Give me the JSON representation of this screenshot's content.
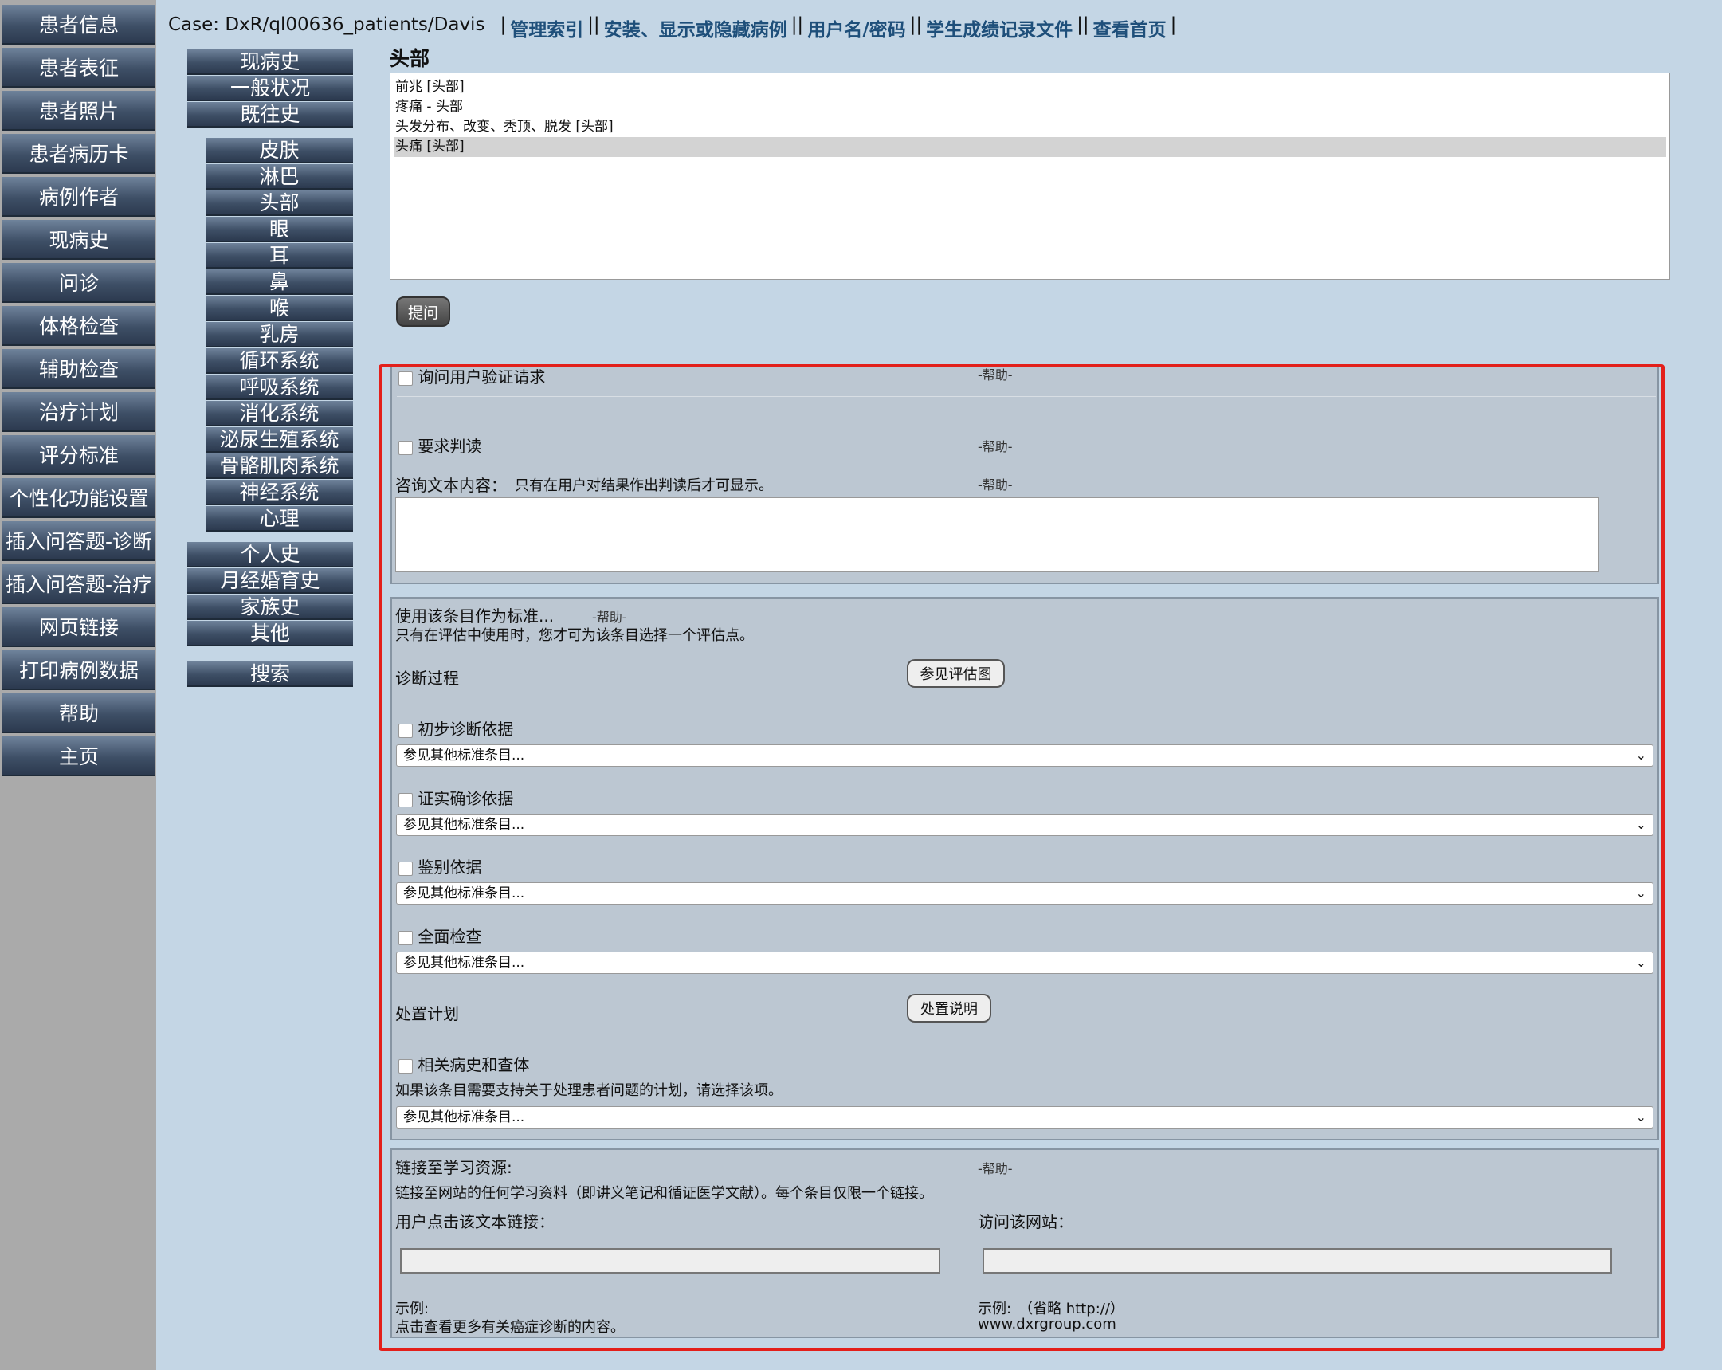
{
  "left_nav": [
    "患者信息",
    "患者表征",
    "患者照片",
    "患者病历卡",
    "病例作者",
    "现病史",
    "问诊",
    "体格检查",
    "辅助检查",
    "治疗计划",
    "评分标准",
    "个性化功能设置",
    "插入问答题-诊断",
    "插入问答题-治疗",
    "网页链接",
    "打印病例数据",
    "帮助",
    "主页"
  ],
  "sub_nav_top": [
    "现病史",
    "一般状况",
    "既往史"
  ],
  "sub_nav_systems": [
    "皮肤",
    "淋巴",
    "头部",
    "眼",
    "耳",
    "鼻",
    "喉",
    "乳房",
    "循环系统",
    "呼吸系统",
    "消化系统",
    "泌尿生殖系统",
    "骨骼肌肉系统",
    "神经系统",
    "心理"
  ],
  "sub_nav_bottom": [
    "个人史",
    "月经婚育史",
    "家族史",
    "其他"
  ],
  "sub_nav_search": "搜索",
  "topbar": {
    "case": "Case: DxR/ql00636_patients/Davis",
    "links": [
      "管理索引",
      "安装、显示或隐藏病例",
      "用户名/密码",
      "学生成绩记录文件",
      "查看首页"
    ],
    "sep": "||",
    "pipe": "|"
  },
  "section_title": "头部",
  "list_items": [
    "前兆 [头部]",
    "疼痛 - 头部",
    "头发分布、改变、秃顶、脱发 [头部]",
    "头痛 [头部]"
  ],
  "list_selected_index": 3,
  "ask_button": "提问",
  "help_label": "-帮助-",
  "panel1": {
    "verify_label": "询问用户验证请求",
    "interpret_label": "要求判读",
    "consult_label": "咨询文本内容：",
    "consult_note": "只有在用户对结果作出判读后才可显示。"
  },
  "panel2": {
    "use_as_standard": "使用该条目作为标准...",
    "use_note": "只有在评估中使用时，您才可为该条目选择一个评估点。",
    "diag_process": "诊断过程",
    "eval_button": "参见评估图",
    "initial_dx": "初步诊断依据",
    "confirm_dx": "证实确诊依据",
    "diff_dx": "鉴别依据",
    "full_exam": "全面检查",
    "treatment_plan": "处置计划",
    "treatment_button": "处置说明",
    "related_history": "相关病史和查体",
    "related_note": "如果该条目需要支持关于处理患者问题的计划，请选择该项。",
    "select_placeholder": "参见其他标准条目..."
  },
  "panel3": {
    "title": "链接至学习资源:",
    "note": "链接至网站的任何学习资料（即讲义笔记和循证医学文献）。每个条目仅限一个链接。",
    "link_text_label": "用户点击该文本链接：",
    "visit_label": "访问该网站：",
    "example_left_title": "示例:",
    "example_left_text": "点击查看更多有关癌症诊断的内容。",
    "example_right_title": "示例:　（省略 http://）",
    "example_right_text": "www.dxrgroup.com"
  },
  "colors": {
    "highlight": "#e3201b",
    "nav_dark": "#3e4f66",
    "page_bg": "#c4d6e5",
    "link": "#1e4f7a"
  }
}
